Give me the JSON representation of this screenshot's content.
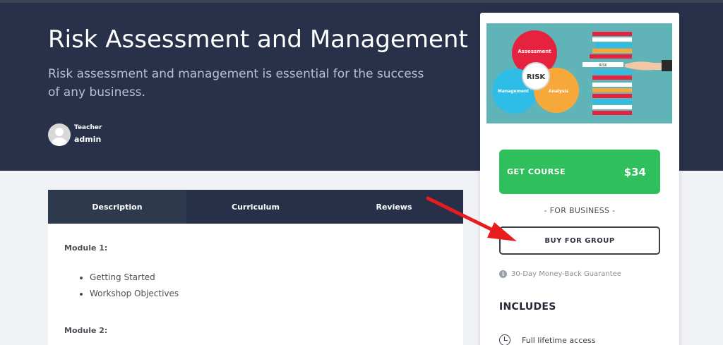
{
  "course": {
    "title": "Risk Assessment and Management",
    "subtitle": "Risk assessment and management is essential for the success of any business.",
    "teacher_label": "Teacher",
    "teacher_name": "admin"
  },
  "tabs": [
    {
      "label": "Description",
      "active": true
    },
    {
      "label": "Curriculum",
      "active": false
    },
    {
      "label": "Reviews",
      "active": false
    }
  ],
  "description": {
    "module1": "Module 1:",
    "module1_items": [
      "Getting Started",
      "Workshop Objectives"
    ],
    "module2": "Module 2:"
  },
  "thumbnail": {
    "labels": [
      "Assessment",
      "RISK",
      "Management",
      "Analysis",
      "RISK"
    ]
  },
  "sidebar": {
    "get_course_label": "GET COURSE",
    "price": "$34",
    "for_business": "- FOR BUSINESS -",
    "buy_group_label": "BUY FOR GROUP",
    "guarantee": "30-Day Money-Back Guarantee",
    "includes_title": "INCLUDES",
    "include_item": "Full lifetime access"
  },
  "colors": {
    "hero_bg": "#283149",
    "accent_green": "#2fbf5c",
    "arrow_red": "#e81c1c"
  }
}
